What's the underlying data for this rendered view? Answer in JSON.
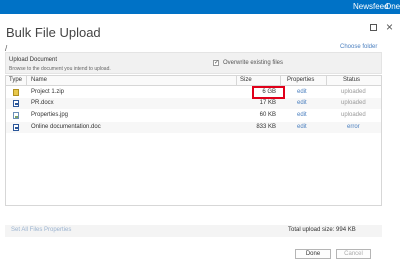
{
  "topbar": {
    "newsfeed": "Newsfeed",
    "one": "One"
  },
  "dialog": {
    "title": "Bulk File Upload",
    "close_glyph": "×",
    "path": "/",
    "choose_folder": "Choose folder",
    "upload_heading": "Upload Document",
    "upload_desc": "Browse to the document you intend to upload.",
    "overwrite_label": "Overwrite existing files",
    "overwrite_checked": true,
    "checkbox_glyph": "✓"
  },
  "table": {
    "headers": {
      "type": "Type",
      "name": "Name",
      "size": "Size",
      "properties": "Properties",
      "status": "Status"
    },
    "rows": [
      {
        "icon": "zip-file-icon",
        "name": "Project 1.zip",
        "size": "6 GB",
        "properties": "edit",
        "status": "uploaded"
      },
      {
        "icon": "word-doc-icon",
        "name": "PR.docx",
        "size": "17 KB",
        "properties": "edit",
        "status": "uploaded"
      },
      {
        "icon": "image-file-icon",
        "name": "Properties.jpg",
        "size": "60 KB",
        "properties": "edit",
        "status": "uploaded"
      },
      {
        "icon": "word-doc-icon",
        "name": "Online documentation.doc",
        "size": "833 KB",
        "properties": "edit",
        "status": "error"
      }
    ]
  },
  "footer": {
    "set_all_props": "Set All Files Properties",
    "total_size": "Total upload size: 994 KB"
  },
  "buttons": {
    "done": "Done",
    "cancel": "Cancel"
  },
  "colors": {
    "topbar": "#0072c6",
    "highlight": "#e0001a",
    "link": "#4a7fbf"
  }
}
